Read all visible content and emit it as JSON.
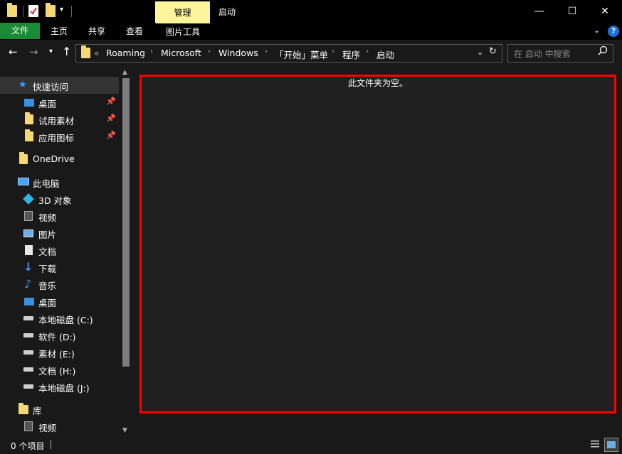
{
  "titlebar": {
    "manage_tab": "管理",
    "window_title": "启动",
    "minimize": "—",
    "maximize": "☐",
    "close": "✕"
  },
  "ribbon": {
    "tabs": [
      "文件",
      "主页",
      "共享",
      "查看",
      "图片工具"
    ]
  },
  "address": {
    "overflow": "«",
    "breadcrumbs": [
      "Roaming",
      "Microsoft",
      "Windows",
      "「开始」菜单",
      "程序",
      "启动"
    ],
    "search_placeholder": "在 启动 中搜索"
  },
  "navpane": {
    "items": [
      {
        "label": "快速访问",
        "icon": "star-icon"
      },
      {
        "label": "桌面",
        "icon": "desktop-icon",
        "pinned": true
      },
      {
        "label": "试用素材",
        "icon": "folder-icon",
        "pinned": true
      },
      {
        "label": "应用图标",
        "icon": "folder-icon",
        "pinned": true
      },
      {
        "label": "OneDrive",
        "icon": "folder-icon"
      },
      {
        "label": "此电脑",
        "icon": "computer-icon"
      },
      {
        "label": "3D 对象",
        "icon": "3d-objects-icon"
      },
      {
        "label": "视频",
        "icon": "video-icon"
      },
      {
        "label": "图片",
        "icon": "pictures-icon"
      },
      {
        "label": "文档",
        "icon": "documents-icon"
      },
      {
        "label": "下载",
        "icon": "download-icon"
      },
      {
        "label": "音乐",
        "icon": "music-icon"
      },
      {
        "label": "桌面",
        "icon": "desktop-icon"
      },
      {
        "label": "本地磁盘 (C:)",
        "icon": "drive-icon"
      },
      {
        "label": "软件 (D:)",
        "icon": "drive-icon"
      },
      {
        "label": "素材 (E:)",
        "icon": "drive-icon"
      },
      {
        "label": "文档 (H:)",
        "icon": "drive-icon"
      },
      {
        "label": "本地磁盘 (J:)",
        "icon": "drive-icon"
      },
      {
        "label": "库",
        "icon": "library-icon"
      },
      {
        "label": "视频",
        "icon": "video-icon"
      }
    ]
  },
  "content": {
    "empty_message": "此文件夹为空。"
  },
  "status": {
    "item_count": "0 个项目"
  },
  "colors": {
    "accent_green": "#1a8a34",
    "manage_yellow": "#fdf59a",
    "highlight_red": "#ff0000"
  }
}
